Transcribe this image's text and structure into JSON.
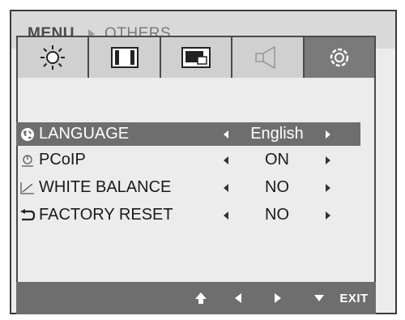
{
  "header": {
    "menu": "MENU",
    "breadcrumb_sub": "OTHERS"
  },
  "tabs": [
    {
      "name": "brightness-icon"
    },
    {
      "name": "picture-icon"
    },
    {
      "name": "screen-position-icon"
    },
    {
      "name": "speaker-icon"
    },
    {
      "name": "settings-icon"
    }
  ],
  "active_tab_index": 4,
  "rows": [
    {
      "label": "LANGUAGE",
      "value": "English",
      "icon": "globe-icon",
      "selected": true
    },
    {
      "label": "PCoIP",
      "value": "ON",
      "icon": "pcoip-icon",
      "selected": false
    },
    {
      "label": "WHITE BALANCE",
      "value": "NO",
      "icon": "white-balance-icon",
      "selected": false
    },
    {
      "label": "FACTORY RESET",
      "value": "NO",
      "icon": "reset-icon",
      "selected": false
    }
  ],
  "footer": {
    "exit_label": "EXIT"
  },
  "colors": {
    "selected_bg": "#6e6e6e",
    "footer_bg": "#6e6e6e",
    "active_tab_bg": "#7a7a7a"
  }
}
